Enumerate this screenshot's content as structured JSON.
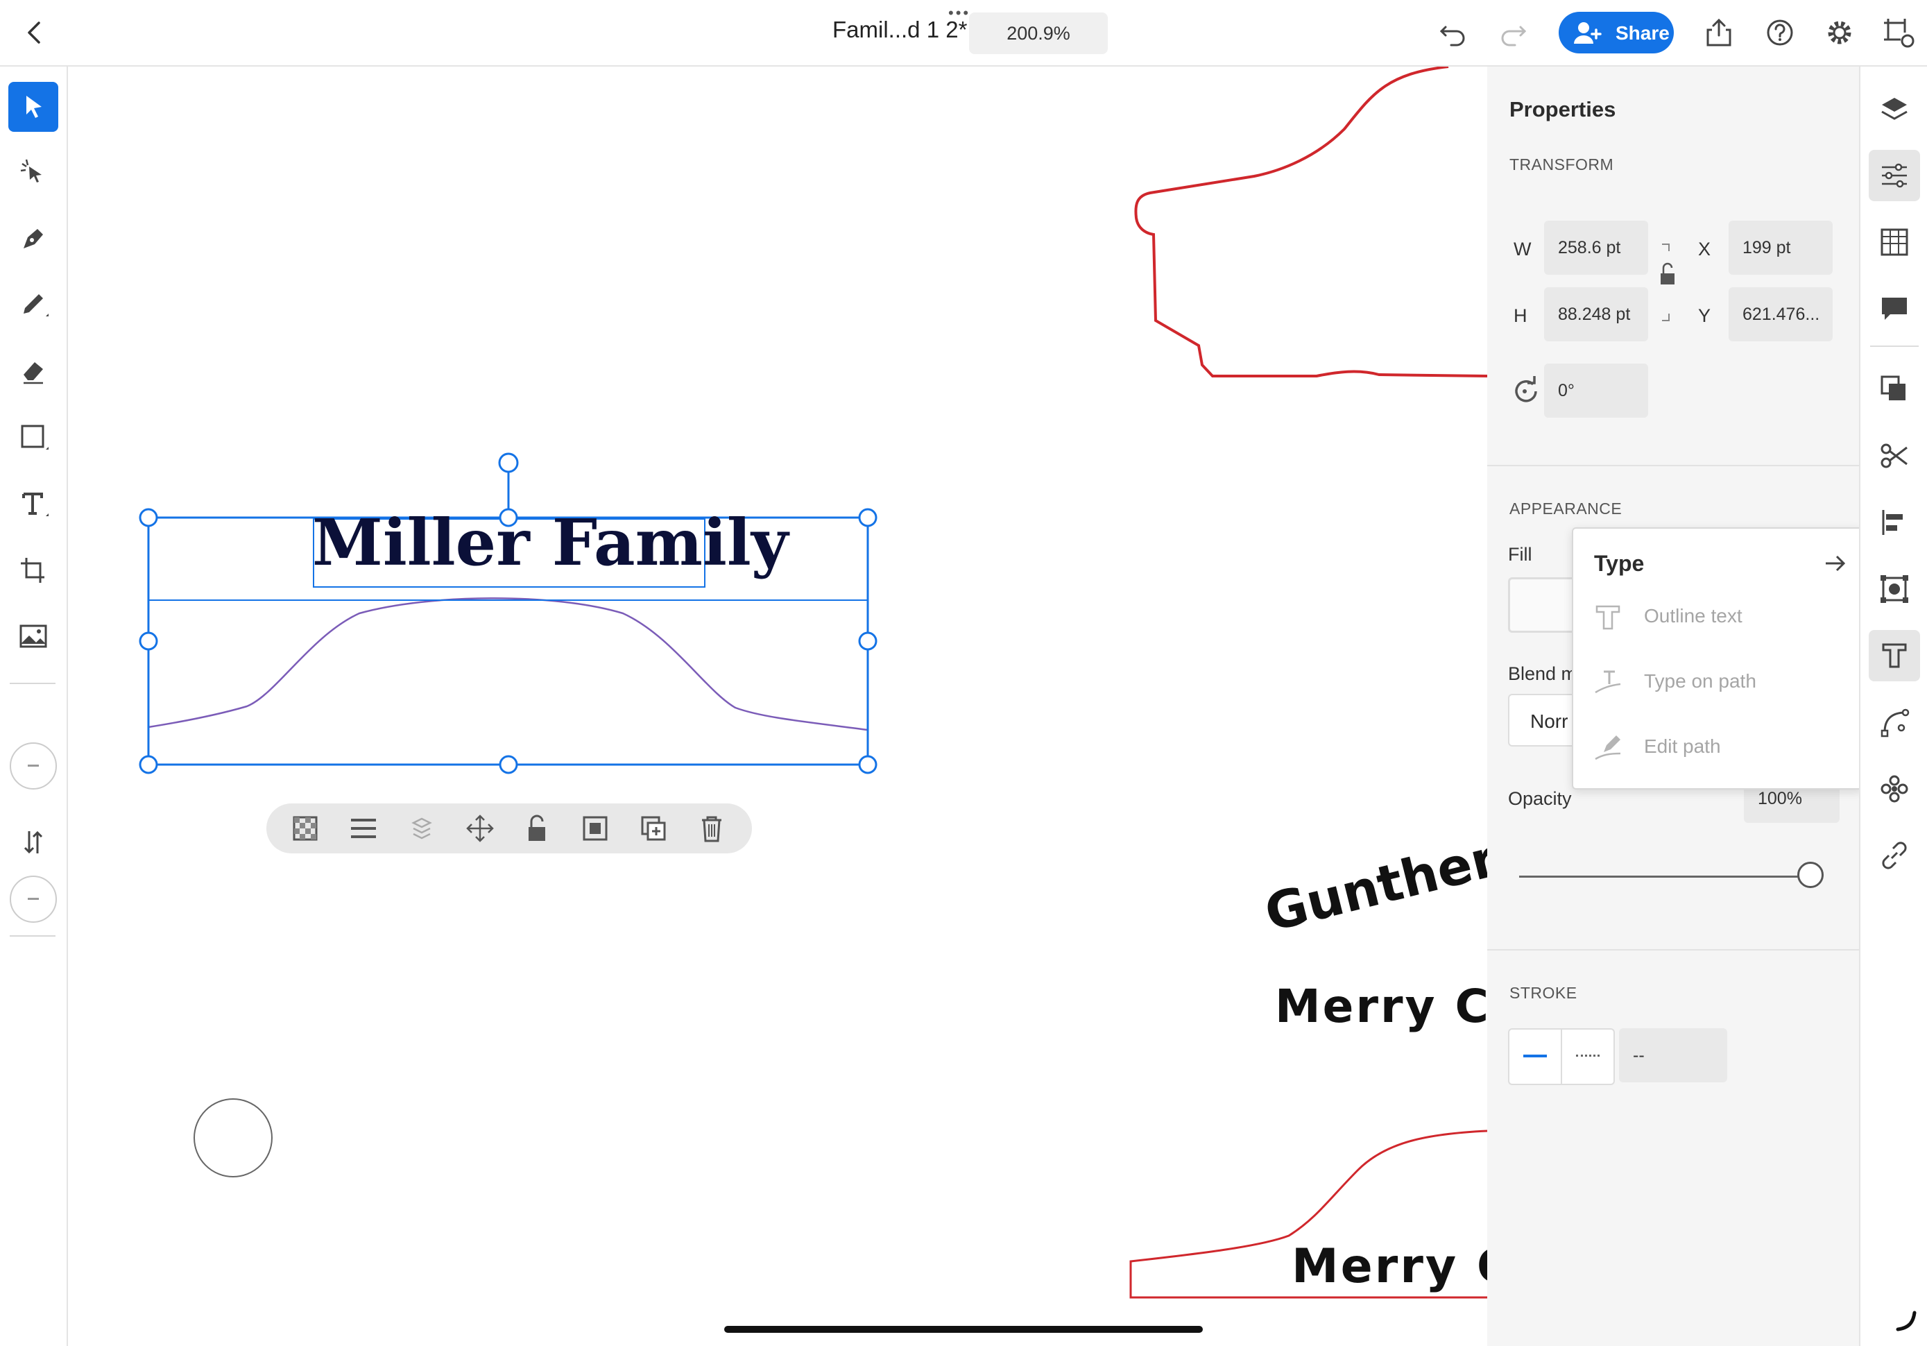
{
  "header": {
    "back_icon": "chevron-left-icon",
    "doc_title": "Famil...d 1 2*",
    "zoom": "200.9%",
    "share_label": "Share",
    "icons": [
      "undo-icon",
      "redo-icon",
      "share-person-icon",
      "export-icon",
      "help-icon",
      "gear-icon",
      "artboard-icon"
    ]
  },
  "left_tools": [
    "selection-tool",
    "direct-selection-tool",
    "pen-tool",
    "pencil-tool",
    "eraser-tool",
    "rectangle-tool",
    "type-tool",
    "crop-tool",
    "image-tool",
    "minus-icon",
    "sort-icon",
    "minus-icon"
  ],
  "canvas": {
    "title_text": "Miller Family",
    "gunther_text": "Gunther",
    "merry_text_1": "Merry Ch",
    "merry_text_2": "Merry C"
  },
  "properties": {
    "title": "Properties",
    "transform_label": "TRANSFORM",
    "w_label": "W",
    "w_value": "258.6 pt",
    "h_label": "H",
    "h_value": "88.248 pt",
    "x_label": "X",
    "x_value": "199 pt",
    "y_label": "Y",
    "y_value": "621.476...",
    "rotation_value": "0°",
    "appearance_label": "APPEARANCE",
    "fill_label": "Fill",
    "blend_label": "Blend m",
    "blend_value": "Norr",
    "opacity_label": "Opacity",
    "opacity_value": "100%",
    "opacity_fraction": 1.0,
    "stroke_label": "STROKE",
    "stroke_value": "--"
  },
  "type_popup": {
    "title": "Type",
    "items": [
      {
        "label": "Outline text"
      },
      {
        "label": "Type on path"
      },
      {
        "label": "Edit path"
      }
    ]
  },
  "rail_icons": [
    "layers-icon",
    "properties-icon",
    "swatches-icon",
    "comments-icon",
    "pathfinder-icon",
    "scissors-icon",
    "align-icon",
    "transform-icon",
    "type-icon",
    "path-icon",
    "repeat-icon",
    "link-icon"
  ],
  "colors": {
    "accent": "#1473e6",
    "red_path": "#d0272c",
    "purple_path": "#7b5cb8"
  }
}
